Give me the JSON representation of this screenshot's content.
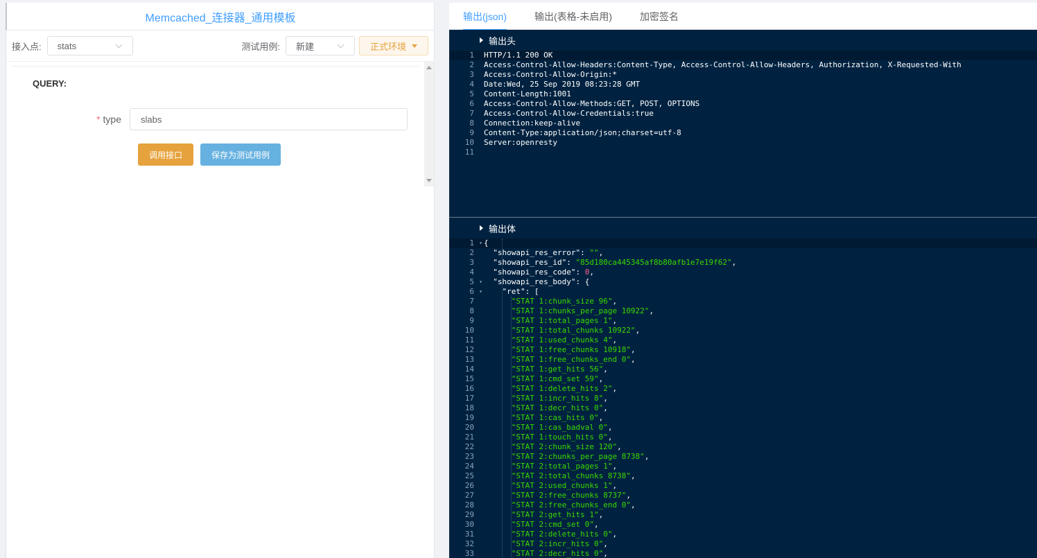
{
  "left": {
    "title": "Memcached_连接器_通用模板",
    "endpoint_label": "接入点:",
    "endpoint_value": "stats",
    "testcase_label": "测试用例:",
    "testcase_value": "新建",
    "env_button": "正式环境",
    "query_label": "QUERY:",
    "field": {
      "required_mark": "*",
      "label": "type",
      "value": "slabs"
    },
    "call_button": "调用接口",
    "save_button": "保存为测试用例"
  },
  "right": {
    "tabs": [
      "输出(json)",
      "输出(表格-未启用)",
      "加密签名"
    ],
    "active_tab": 0,
    "header_section_title": "输出头",
    "body_section_title": "输出体",
    "header_lines": [
      "HTTP/1.1 200 OK",
      "Access-Control-Allow-Headers:Content-Type, Access-Control-Allow-Headers, Authorization, X-Requested-With",
      "Access-Control-Allow-Origin:*",
      "Date:Wed, 25 Sep 2019 08:23:28 GMT",
      "Content-Length:1001",
      "Access-Control-Allow-Methods:GET, POST, OPTIONS",
      "Access-Control-Allow-Credentials:true",
      "Connection:keep-alive",
      "Content-Type:application/json;charset=utf-8",
      "Server:openresty",
      ""
    ],
    "body_open": "{",
    "body_fields": {
      "error_key": "\"showapi_res_error\"",
      "error_val": "\"\"",
      "id_key": "\"showapi_res_id\"",
      "id_val": "\"85d180ca445345af8b80afb1e7e19f62\"",
      "code_key": "\"showapi_res_code\"",
      "code_val": "0",
      "body_key": "\"showapi_res_body\"",
      "ret_key": "\"ret\""
    },
    "ret_items": [
      "STAT 1:chunk_size 96",
      "STAT 1:chunks_per_page 10922",
      "STAT 1:total_pages 1",
      "STAT 1:total_chunks 10922",
      "STAT 1:used_chunks 4",
      "STAT 1:free_chunks 10918",
      "STAT 1:free_chunks_end 0",
      "STAT 1:get_hits 56",
      "STAT 1:cmd_set 59",
      "STAT 1:delete_hits 2",
      "STAT 1:incr_hits 8",
      "STAT 1:decr_hits 0",
      "STAT 1:cas_hits 0",
      "STAT 1:cas_badval 0",
      "STAT 1:touch_hits 0",
      "STAT 2:chunk_size 120",
      "STAT 2:chunks_per_page 8738",
      "STAT 2:total_pages 1",
      "STAT 2:total_chunks 8738",
      "STAT 2:used_chunks 1",
      "STAT 2:free_chunks 8737",
      "STAT 2:free_chunks_end 0",
      "STAT 2:get_hits 1",
      "STAT 2:cmd_set 0",
      "STAT 2:delete_hits 0",
      "STAT 2:incr_hits 0",
      "STAT 2:decr_hits 0"
    ]
  }
}
